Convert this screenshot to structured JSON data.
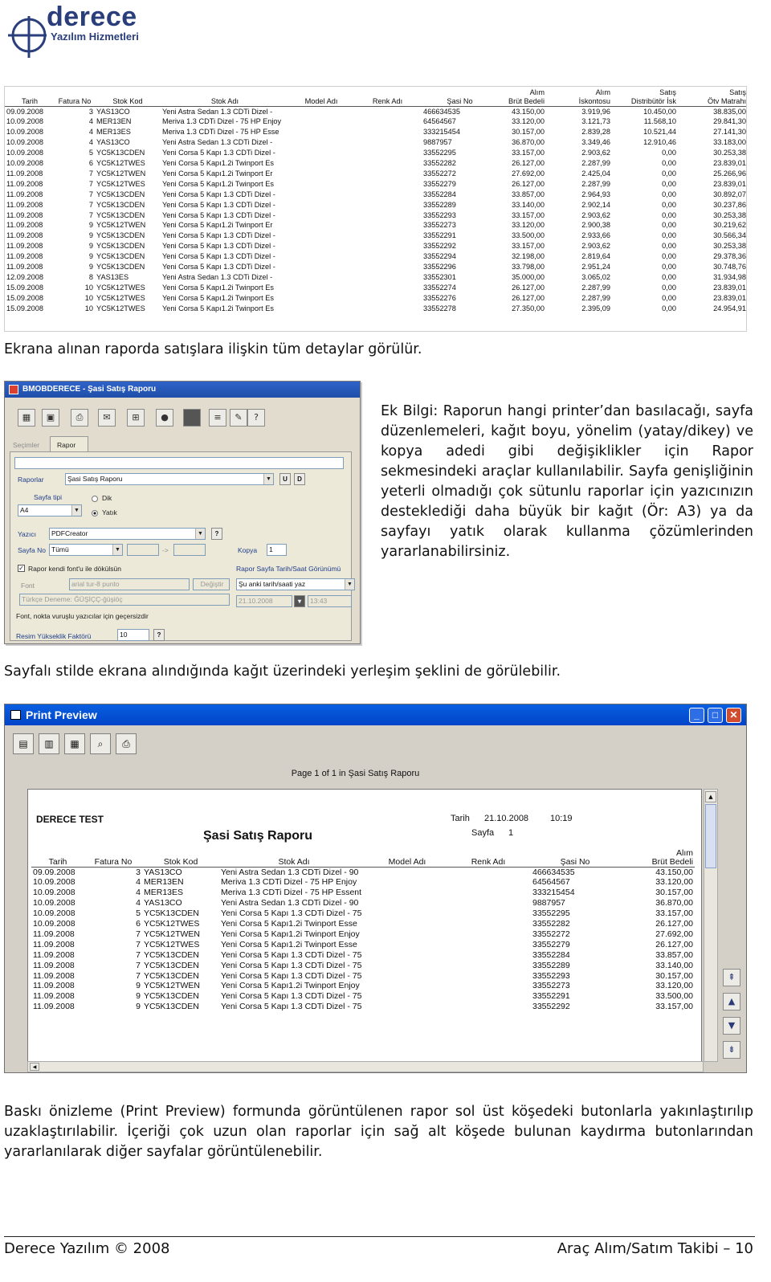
{
  "logo": {
    "word": "derece",
    "sub": "Yazılım Hizmetleri"
  },
  "report1": {
    "headers": [
      "Tarih",
      "Fatura No",
      "Stok Kod",
      "Stok Adı",
      "Model Adı",
      "Renk Adı",
      "Şasi No",
      "Alım\nBrüt Bedeli",
      "Alım\nİskontosu",
      "Satış\nDistribütör İsk",
      "Satış\nÖtv Matrahı"
    ],
    "rows": [
      [
        "09.09.2008",
        "3",
        "YAS13CO",
        "Yeni Astra Sedan 1.3 CDTi Dizel -",
        "",
        "",
        "466634535",
        "43.150,00",
        "3.919,96",
        "10.450,00",
        "38.835,00"
      ],
      [
        "10.09.2008",
        "4",
        "MER13EN",
        "Meriva 1.3 CDTi Dizel - 75 HP Enjoy",
        "",
        "",
        "64564567",
        "33.120,00",
        "3.121,73",
        "11.568,10",
        "29.841,30"
      ],
      [
        "10.09.2008",
        "4",
        "MER13ES",
        "Meriva 1.3 CDTi Dizel - 75 HP Esse",
        "",
        "",
        "333215454",
        "30.157,00",
        "2.839,28",
        "10.521,44",
        "27.141,30"
      ],
      [
        "10.09.2008",
        "4",
        "YAS13CO",
        "Yeni Astra Sedan 1.3 CDTi Dizel -",
        "",
        "",
        "9887957",
        "36.870,00",
        "3.349,46",
        "12.910,46",
        "33.183,00"
      ],
      [
        "10.09.2008",
        "5",
        "YC5K13CDEN",
        "Yeni Corsa 5 Kapı 1.3 CDTi Dizel -",
        "",
        "",
        "33552295",
        "33.157,00",
        "2.903,62",
        "0,00",
        "30.253,38"
      ],
      [
        "10.09.2008",
        "6",
        "YC5K12TWES",
        "Yeni Corsa 5 Kapı1.2i Twinport Es",
        "",
        "",
        "33552282",
        "26.127,00",
        "2.287,99",
        "0,00",
        "23.839,01"
      ],
      [
        "11.09.2008",
        "7",
        "YC5K12TWEN",
        "Yeni Corsa 5 Kapı1.2i Twinport Er",
        "",
        "",
        "33552272",
        "27.692,00",
        "2.425,04",
        "0,00",
        "25.266,96"
      ],
      [
        "11.09.2008",
        "7",
        "YC5K12TWES",
        "Yeni Corsa 5 Kapı1.2i Twinport Es",
        "",
        "",
        "33552279",
        "26.127,00",
        "2.287,99",
        "0,00",
        "23.839,01"
      ],
      [
        "11.09.2008",
        "7",
        "YC5K13CDEN",
        "Yeni Corsa 5 Kapı 1.3 CDTi Dizel -",
        "",
        "",
        "33552284",
        "33.857,00",
        "2.964,93",
        "0,00",
        "30.892,07"
      ],
      [
        "11.09.2008",
        "7",
        "YC5K13CDEN",
        "Yeni Corsa 5 Kapı 1.3 CDTi Dizel -",
        "",
        "",
        "33552289",
        "33.140,00",
        "2.902,14",
        "0,00",
        "30.237,86"
      ],
      [
        "11.09.2008",
        "7",
        "YC5K13CDEN",
        "Yeni Corsa 5 Kapı 1.3 CDTi Dizel -",
        "",
        "",
        "33552293",
        "33.157,00",
        "2.903,62",
        "0,00",
        "30.253,38"
      ],
      [
        "11.09.2008",
        "9",
        "YC5K12TWEN",
        "Yeni Corsa 5 Kapı1.2i Twinport Er",
        "",
        "",
        "33552273",
        "33.120,00",
        "2.900,38",
        "0,00",
        "30.219,62"
      ],
      [
        "11.09.2008",
        "9",
        "YC5K13CDEN",
        "Yeni Corsa 5 Kapı 1.3 CDTi Dizel -",
        "",
        "",
        "33552291",
        "33.500,00",
        "2.933,66",
        "0,00",
        "30.566,34"
      ],
      [
        "11.09.2008",
        "9",
        "YC5K13CDEN",
        "Yeni Corsa 5 Kapı 1.3 CDTi Dizel -",
        "",
        "",
        "33552292",
        "33.157,00",
        "2.903,62",
        "0,00",
        "30.253,38"
      ],
      [
        "11.09.2008",
        "9",
        "YC5K13CDEN",
        "Yeni Corsa 5 Kapı 1.3 CDTi Dizel -",
        "",
        "",
        "33552294",
        "32.198,00",
        "2.819,64",
        "0,00",
        "29.378,36"
      ],
      [
        "11.09.2008",
        "9",
        "YC5K13CDEN",
        "Yeni Corsa 5 Kapı 1.3 CDTi Dizel -",
        "",
        "",
        "33552296",
        "33.798,00",
        "2.951,24",
        "0,00",
        "30.748,76"
      ],
      [
        "12.09.2008",
        "8",
        "YAS13ES",
        "Yeni Astra Sedan 1.3 CDTi Dizel -",
        "",
        "",
        "33552301",
        "35.000,00",
        "3.065,02",
        "0,00",
        "31.934,98"
      ],
      [
        "15.09.2008",
        "10",
        "YC5K12TWES",
        "Yeni Corsa 5 Kapı1.2i Twinport Es",
        "",
        "",
        "33552274",
        "26.127,00",
        "2.287,99",
        "0,00",
        "23.839,01"
      ],
      [
        "15.09.2008",
        "10",
        "YC5K12TWES",
        "Yeni Corsa 5 Kapı1.2i Twinport Es",
        "",
        "",
        "33552276",
        "26.127,00",
        "2.287,99",
        "0,00",
        "23.839,01"
      ],
      [
        "15.09.2008",
        "10",
        "YC5K12TWES",
        "Yeni Corsa 5 Kapı1.2i Twinport Es",
        "",
        "",
        "33552278",
        "27.350,00",
        "2.395,09",
        "0,00",
        "24.954,91"
      ]
    ]
  },
  "caption1": "Ekrana alınan raporda satışlara ilişkin tüm detaylar görülür.",
  "dialog": {
    "title": "BMOBDERECE - Şasi Satış Raporu",
    "tabs": [
      "Seçimler",
      "Rapor"
    ],
    "rapor_label": "Raporlar",
    "rapor_value": "Şasi Satış Raporu",
    "btn_u": "U",
    "btn_d": "D",
    "sayfa_tipi_label": "Sayfa tipi",
    "sayfa_tipi_value": "A4",
    "dik": "Dik",
    "yatik": "Yatık",
    "yazici_label": "Yazıcı",
    "yazici_value": "PDFCreator",
    "q": "?",
    "sayfa_no_label": "Sayfa No",
    "sayfa_no_value": "Tümü",
    "range_sep": "->",
    "kopya_label": "Kopya",
    "kopya_value": "1",
    "chk_font": "Rapor kendi font'u ile dökülsün",
    "chk_tarih": "Rapor Sayfa Tarih/Saat Görünümü",
    "font_label": "Font",
    "font_value": "arial tur-8 punto",
    "degistir": "Değiştir",
    "tarih_value": "Şu anki tarih/saati yaz",
    "test_value": "Türkçe Deneme: ĞÜŞİÇÇ-ğüşiöç",
    "date_value": "21.10.2008",
    "time_value": "13:43",
    "note": "Font, nokta vuruşlu yazıcılar için geçersizdir",
    "resim_label": "Resim Yükseklik Faktörü",
    "resim_value": "10"
  },
  "aside": "Ek Bilgi: Raporun hangi printer’dan basılacağı, sayfa düzenlemeleri, kağıt boyu, yönelim (yatay/dikey) ve kopya adedi gibi değişiklikler için Rapor sekmesindeki araçlar kullanılabilir. Sayfa genişliğinin yeterli olmadığı çok sütunlu raporlar için yazıcınızın desteklediği daha büyük bir kağıt (Ör: A3) ya da sayfayı yatık olarak kullanma çözümlerinden yararlanabilirsiniz.",
  "caption2": "Sayfalı stilde ekrana alındığında kağıt üzerindeki yerleşim şeklini de görülebilir.",
  "preview": {
    "title": "Print Preview",
    "page_caption": "Page 1 of 1 in Şasi Satış Raporu",
    "company": "DERECE TEST",
    "report_title": "Şasi Satış Raporu",
    "tarih_label": "Tarih",
    "tarih_value": "21.10.2008",
    "time_value": "10:19",
    "sayfa_label": "Sayfa",
    "sayfa_value": "1",
    "headers": [
      "Tarih",
      "Fatura No",
      "Stok Kod",
      "Stok Adı",
      "Model Adı",
      "Renk Adı",
      "Şasi No",
      "Alım\nBrüt Bedeli"
    ],
    "rows": [
      [
        "09.09.2008",
        "3",
        "YAS13CO",
        "Yeni Astra Sedan 1.3 CDTi Dizel - 90",
        "",
        "",
        "466634535",
        "43.150,00"
      ],
      [
        "10.09.2008",
        "4",
        "MER13EN",
        "Meriva 1.3 CDTi Dizel - 75 HP Enjoy",
        "",
        "",
        "64564567",
        "33.120,00"
      ],
      [
        "10.09.2008",
        "4",
        "MER13ES",
        "Meriva 1.3 CDTi Dizel - 75 HP Essent",
        "",
        "",
        "333215454",
        "30.157,00"
      ],
      [
        "10.09.2008",
        "4",
        "YAS13CO",
        "Yeni Astra Sedan 1.3 CDTi Dizel - 90",
        "",
        "",
        "9887957",
        "36.870,00"
      ],
      [
        "10.09.2008",
        "5",
        "YC5K13CDEN",
        "Yeni Corsa 5 Kapı 1.3 CDTi Dizel - 75",
        "",
        "",
        "33552295",
        "33.157,00"
      ],
      [
        "10.09.2008",
        "6",
        "YC5K12TWES",
        "Yeni Corsa 5 Kapı1.2i Twinport Esse",
        "",
        "",
        "33552282",
        "26.127,00"
      ],
      [
        "11.09.2008",
        "7",
        "YC5K12TWEN",
        "Yeni Corsa 5 Kapı1.2i Twinport Enjoy",
        "",
        "",
        "33552272",
        "27.692,00"
      ],
      [
        "11.09.2008",
        "7",
        "YC5K12TWES",
        "Yeni Corsa 5 Kapı1.2i Twinport Esse",
        "",
        "",
        "33552279",
        "26.127,00"
      ],
      [
        "11.09.2008",
        "7",
        "YC5K13CDEN",
        "Yeni Corsa 5 Kapı 1.3 CDTi Dizel - 75",
        "",
        "",
        "33552284",
        "33.857,00"
      ],
      [
        "11.09.2008",
        "7",
        "YC5K13CDEN",
        "Yeni Corsa 5 Kapı 1.3 CDTi Dizel - 75",
        "",
        "",
        "33552289",
        "33.140,00"
      ],
      [
        "11.09.2008",
        "7",
        "YC5K13CDEN",
        "Yeni Corsa 5 Kapı 1.3 CDTi Dizel - 75",
        "",
        "",
        "33552293",
        "30.157,00"
      ],
      [
        "11.09.2008",
        "9",
        "YC5K12TWEN",
        "Yeni Corsa 5 Kapı1.2i Twinport Enjoy",
        "",
        "",
        "33552273",
        "33.120,00"
      ],
      [
        "11.09.2008",
        "9",
        "YC5K13CDEN",
        "Yeni Corsa 5 Kapı 1.3 CDTi Dizel - 75",
        "",
        "",
        "33552291",
        "33.500,00"
      ],
      [
        "11.09.2008",
        "9",
        "YC5K13CDEN",
        "Yeni Corsa 5 Kapı 1.3 CDTi Dizel - 75",
        "",
        "",
        "33552292",
        "33.157,00"
      ]
    ]
  },
  "caption3": "Baskı önizleme (Print Preview) formunda görüntülenen rapor sol üst köşedeki butonlarla yakınlaştırılıp uzaklaştırılabilir. İçeriği çok uzun olan raporlar için sağ alt köşede bulunan kaydırma butonlarından yararlanılarak diğer sayfalar görüntülenebilir.",
  "footer": {
    "left": "Derece Yazılım © 2008",
    "right": "Araç Alım/Satım Takibi – 10"
  }
}
